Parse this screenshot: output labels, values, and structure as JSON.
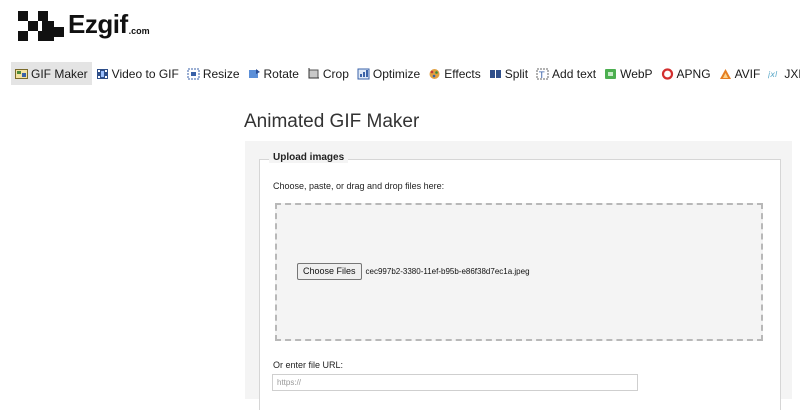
{
  "header": {
    "logo_text": "Ezgif",
    "logo_suffix": ".com"
  },
  "nav": {
    "items": [
      {
        "label": "GIF Maker",
        "icon": "gif-maker-icon",
        "active": true
      },
      {
        "label": "Video to GIF",
        "icon": "video-icon"
      },
      {
        "label": "Resize",
        "icon": "resize-icon"
      },
      {
        "label": "Rotate",
        "icon": "rotate-icon"
      },
      {
        "label": "Crop",
        "icon": "crop-icon"
      },
      {
        "label": "Optimize",
        "icon": "optimize-icon"
      },
      {
        "label": "Effects",
        "icon": "effects-icon"
      },
      {
        "label": "Split",
        "icon": "split-icon"
      },
      {
        "label": "Add text",
        "icon": "add-text-icon"
      },
      {
        "label": "WebP",
        "icon": "webp-icon"
      },
      {
        "label": "APNG",
        "icon": "apng-icon"
      },
      {
        "label": "AVIF",
        "icon": "avif-icon"
      },
      {
        "label": "JXL",
        "icon": "jxl-icon"
      }
    ]
  },
  "main": {
    "title": "Animated GIF Maker",
    "upload": {
      "legend": "Upload images",
      "instructions": "Choose, paste, or drag and drop files here:",
      "choose_button": "Choose Files",
      "file_name": "cec997b2-3380-11ef-b95b-e86f38d7ec1a.jpeg",
      "url_label": "Or enter file URL:",
      "url_placeholder": "https://",
      "url_value": ""
    }
  },
  "colors": {
    "panel_bg": "#f4f4f4",
    "active_nav_bg": "#e4e4e4",
    "dropzone_border": "#b8b8b8"
  }
}
